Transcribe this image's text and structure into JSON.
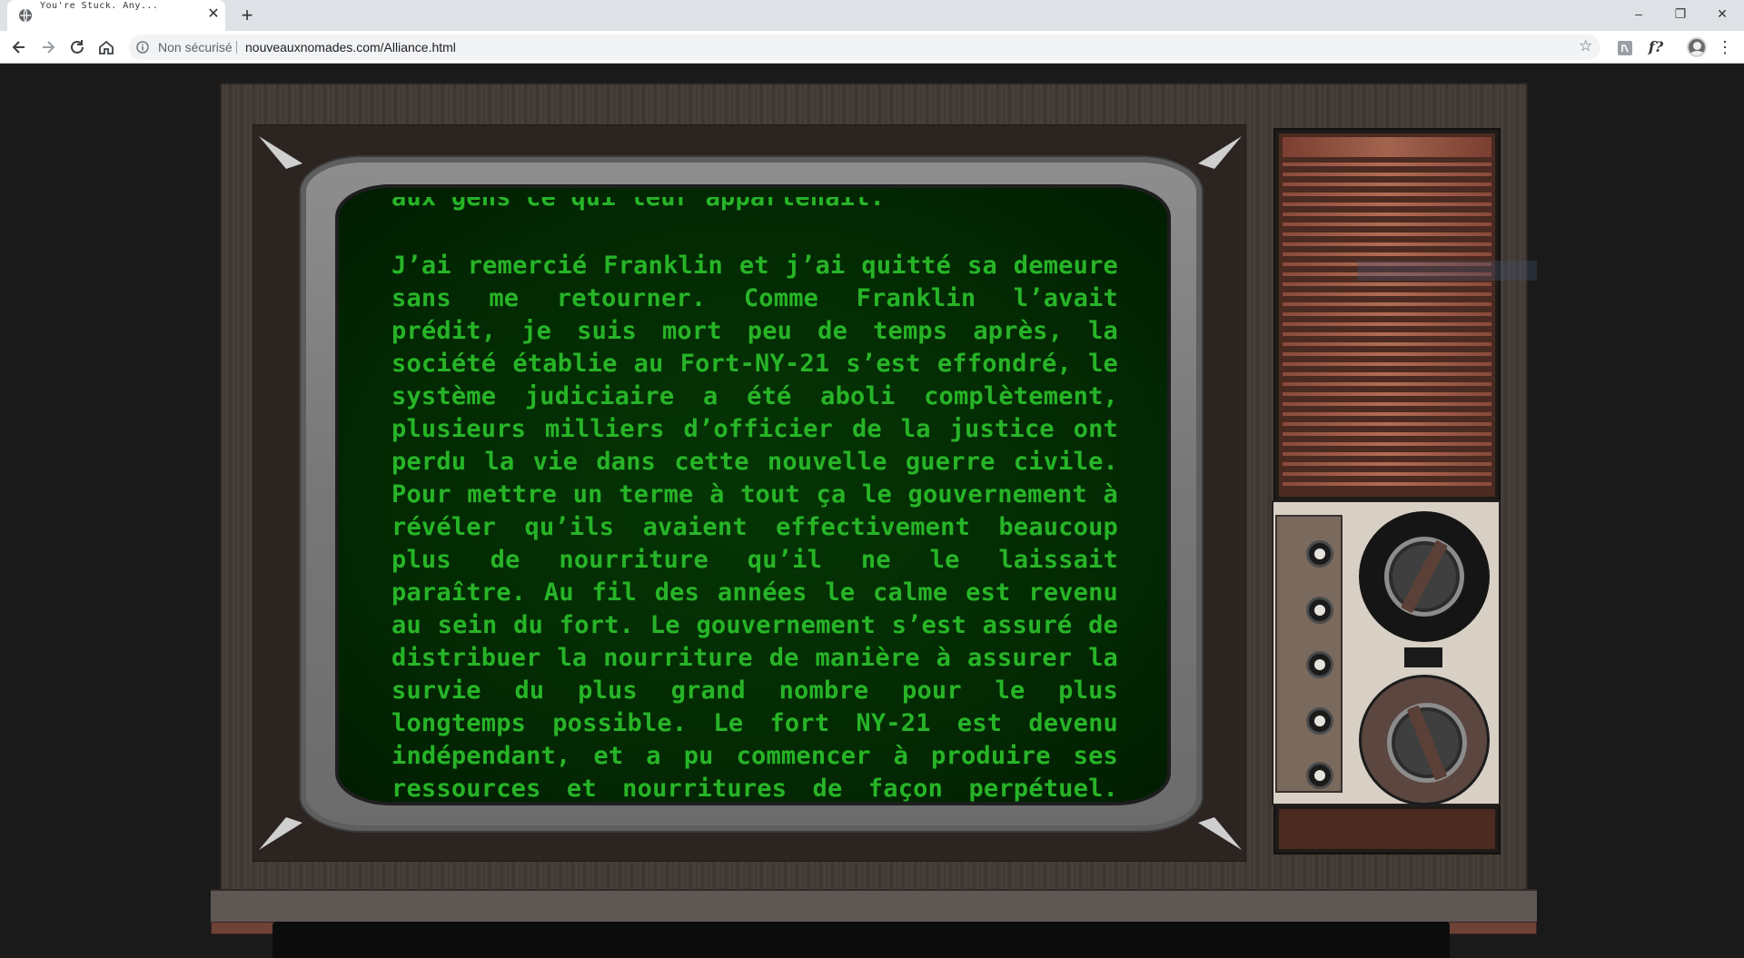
{
  "browser": {
    "tab_title": "You're Stuck. Any...",
    "tab_close": "✕",
    "new_tab": "+",
    "window_controls": {
      "minimize": "–",
      "restore": "❐",
      "close": "✕"
    },
    "security_label": "Non sécurisé",
    "url": "nouveauxnomades.com/Alliance.html",
    "extension_f": "f?",
    "menu": "⋮"
  },
  "screen": {
    "cut_line": "aux gens ce qui leur appartenait.",
    "paragraph": "J’ai remercié Franklin et j’ai quitté sa demeure sans me retourner. Comme Franklin l’avait prédit, je suis mort peu de temps après, la société établie au Fort-NY-21 s’est effondré, le système judiciaire a été aboli complètement, plusieurs milliers d’officier de la justice ont perdu la vie dans cette nouvelle guerre civile. Pour mettre un terme à tout ça le gouvernement à révéler qu’ils avaient effectivement beaucoup plus de nourriture qu’il ne le laissait paraître. Au fil des années le calme est revenu au sein du fort. Le gouvernement s’est assuré de distribuer la nourriture de manière à assurer la survie du plus grand nombre pour le plus longtemps possible. Le fort NY-21 est devenu indépendant, et a pu commencer à produire ses ressources et nourritures de façon perpétuel. Peut-être",
    "text_color": "#27b427"
  },
  "icons": {
    "favicon": "globe-icon",
    "back": "arrow-left-icon",
    "forward": "arrow-right-icon",
    "reload": "reload-icon",
    "home": "home-icon",
    "info": "info-icon",
    "bookmark": "star-icon",
    "extension": "extension-icon",
    "profile": "avatar-icon"
  }
}
